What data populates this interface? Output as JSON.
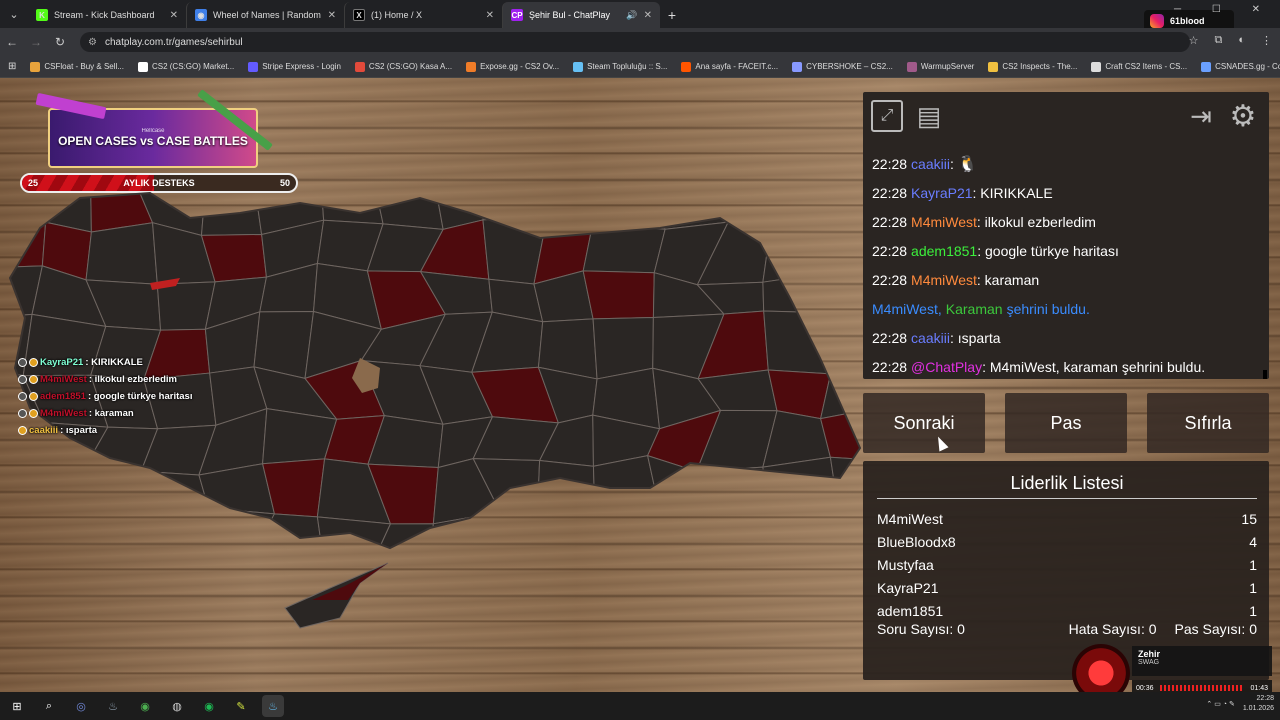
{
  "browser": {
    "tabs": [
      {
        "title": "Stream - Kick Dashboard",
        "favicon_color": "#53fc18",
        "favicon_glyph": "K",
        "active": false
      },
      {
        "title": "Wheel of Names | Random nam",
        "favicon_color": "#3f7fe8",
        "favicon_glyph": "◉",
        "active": false
      },
      {
        "title": "(1) Home / X",
        "favicon_color": "#000000",
        "favicon_glyph": "X",
        "active": false
      },
      {
        "title": "Şehir Bul - ChatPlay",
        "favicon_color": "#a020f0",
        "favicon_glyph": "CP",
        "active": true
      }
    ],
    "url": "chatplay.com.tr/games/sehirbul",
    "profile_label": "61blood",
    "bookmarks": [
      {
        "label": "CSFloat - Buy & Sell...",
        "color": "#e8a33c"
      },
      {
        "label": "CS2 (CS:GO) Market...",
        "color": "#ffffff"
      },
      {
        "label": "Stripe Express - Login",
        "color": "#635bff"
      },
      {
        "label": "CS2 (CS:GO) Kasa A...",
        "color": "#e24a3b"
      },
      {
        "label": "Expose.gg - CS2 Ov...",
        "color": "#f07c28"
      },
      {
        "label": "Steam Topluluğu :: S...",
        "color": "#66c0f4"
      },
      {
        "label": "Ana sayfa - FACEIT.c...",
        "color": "#ff5500"
      },
      {
        "label": "CYBERSHOKE – CS2...",
        "color": "#8899ff"
      },
      {
        "label": "WarmupServer",
        "color": "#a05a8a"
      },
      {
        "label": "CS2 Inspects - The...",
        "color": "#f0c040"
      },
      {
        "label": "Craft CS2 Items - CS...",
        "color": "#dddddd"
      },
      {
        "label": "CSNADES.gg - Cou...",
        "color": "#6aa0ff"
      }
    ]
  },
  "stream_overlay": {
    "banner_sub": "Hellcase",
    "banner_main": "OPEN CASES vs CASE BATTLES",
    "support_min": "25",
    "support_label": "AYLIK DESTEKS",
    "support_max": "50",
    "support_fraction": 0.48,
    "chat": [
      {
        "user": "KayraP21",
        "text": " : KIRIKKALE",
        "color": "#7fffd4"
      },
      {
        "user": "M4miWest",
        "text": " : ilkokul ezberledim",
        "color": "#c0102a"
      },
      {
        "user": "adem1851",
        "text": " : google türkye haritası",
        "color": "#c0102a"
      },
      {
        "user": "M4miWest",
        "text": " : karaman",
        "color": "#c0102a"
      },
      {
        "user": "caakiii",
        "text": " : ısparta",
        "color": "#f0c040"
      }
    ]
  },
  "game": {
    "tools": {
      "fullscreen": "fullscreen-icon",
      "notes": "notes-icon",
      "exit": "exit-icon",
      "settings": "gear-icon"
    },
    "chat": [
      {
        "time": "22:28",
        "user": "caakiii",
        "user_color": "#6a7dff",
        "text": ":",
        "emote": true
      },
      {
        "time": "22:28",
        "user": "KayraP21",
        "user_color": "#6a7dff",
        "text": ": KIRIKKALE"
      },
      {
        "time": "22:28",
        "user": "M4miWest",
        "user_color": "#ff8a3d",
        "text": ": ilkokul ezberledim"
      },
      {
        "time": "22:28",
        "user": "adem1851",
        "user_color": "#3cf03c",
        "text": ": google türkye haritası"
      },
      {
        "time": "22:28",
        "user": "M4miWest",
        "user_color": "#ff8a3d",
        "text": ": karaman"
      },
      {
        "system": true,
        "p1": "M4miWest,",
        "city": "Karaman",
        "p2": "şehrini buldu."
      },
      {
        "time": "22:28",
        "user": "caakiii",
        "user_color": "#6a7dff",
        "text": ": ısparta"
      },
      {
        "time": "22:28",
        "user": "@ChatPlay",
        "user_color": "#e030e0",
        "text": ": M4miWest, karaman şehrini buldu."
      }
    ],
    "buttons": {
      "next": "Sonraki",
      "pass": "Pas",
      "reset": "Sıfırla"
    },
    "leaderboard": {
      "title": "Liderlik Listesi",
      "rows": [
        {
          "name": "M4miWest",
          "score": "15"
        },
        {
          "name": "BlueBloodx8",
          "score": "4"
        },
        {
          "name": "Mustyfaa",
          "score": "1"
        },
        {
          "name": "KayraP21",
          "score": "1"
        },
        {
          "name": "adem1851",
          "score": "1"
        }
      ],
      "stats": {
        "questions": "Soru Sayısı: 0",
        "errors": "Hata Sayısı: 0",
        "passes": "Pas Sayısı: 0"
      }
    }
  },
  "player": {
    "track": "Zehir",
    "artist": "SWAG",
    "elapsed": "00:36",
    "duration": "01:43"
  },
  "taskbar": {
    "apps": [
      "windows-icon",
      "search-icon",
      "discord-icon",
      "steam-icon",
      "chrome-icon",
      "obs-icon",
      "spotify-icon",
      "app-icon",
      "steam-active-icon"
    ],
    "time": "22:28",
    "date": "1.01.2026"
  },
  "colors": {
    "province_dark": "#2a2624",
    "province_found": "#4e0a0d",
    "accent_red": "#d0101a"
  }
}
